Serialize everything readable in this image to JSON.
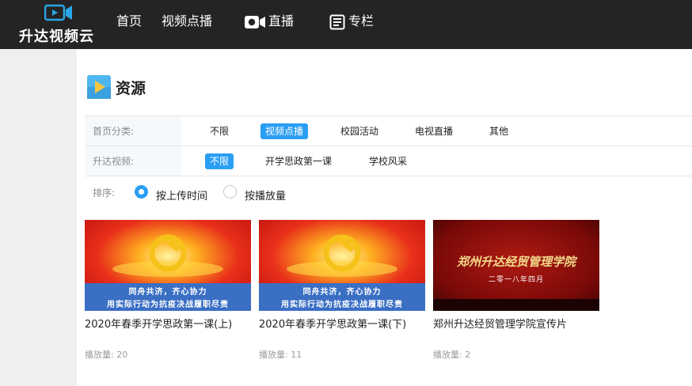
{
  "header": {
    "logo_text": "升达视频云",
    "nav": {
      "home": "首页",
      "vod": "视频点播",
      "live": "直播",
      "column": "专栏"
    }
  },
  "section": {
    "title": "资源"
  },
  "filters": {
    "category_label": "首页分类:",
    "category_options": [
      "不限",
      "视频点播",
      "校园活动",
      "电视直播",
      "其他"
    ],
    "category_selected": "视频点播",
    "sub_label": "升达视频:",
    "sub_options": [
      "不限",
      "开学思政第一课",
      "学校风采"
    ],
    "sub_selected": "不限"
  },
  "sort": {
    "label": "排序:",
    "options": [
      "按上传时间",
      "按播放量"
    ],
    "selected": "按上传时间"
  },
  "videos": [
    {
      "title": "2020年春季开学思政第一课(上)",
      "views": "播放量: 20",
      "banner_line1": "同舟共济，齐心协力",
      "banner_line2": "用实际行动为抗疫决战履职尽责"
    },
    {
      "title": "2020年春季开学思政第一课(下)",
      "views": "播放量: 11",
      "banner_line1": "同舟共济，齐心协力",
      "banner_line2": "用实际行动为抗疫决战履职尽责"
    },
    {
      "title": "郑州升达经贸管理学院宣传片",
      "views": "播放量: 2",
      "banner_line1": "郑州升达经贸管理学院",
      "banner_line2": "二零一八年四月"
    }
  ],
  "colors": {
    "header_bg": "#242424",
    "accent": "#2a9ef3",
    "logo_blue": "#2aa7e8"
  }
}
